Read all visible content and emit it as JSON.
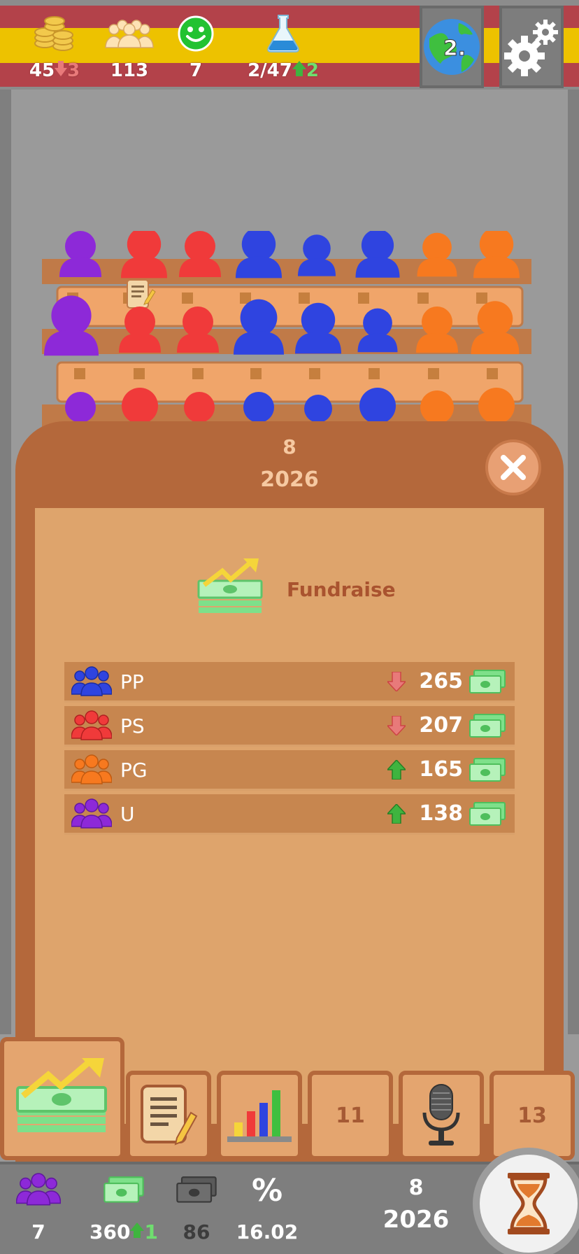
{
  "top": {
    "coins": {
      "value": "45",
      "change": "3"
    },
    "population": {
      "value": "113"
    },
    "happiness": {
      "value": "7"
    },
    "research": {
      "value": "2/47",
      "change": "2"
    },
    "world_button": {
      "label": "2."
    }
  },
  "panel": {
    "turn": "8",
    "year": "2026",
    "action": "Fundraise",
    "rows": [
      {
        "party": "PP",
        "amount": "265",
        "trend": "down",
        "color": "#2f44e0"
      },
      {
        "party": "PS",
        "amount": "207",
        "trend": "down",
        "color": "#f03a3a"
      },
      {
        "party": "PG",
        "amount": "165",
        "trend": "up",
        "color": "#f7791f"
      },
      {
        "party": "U",
        "amount": "138",
        "trend": "up",
        "color": "#8d29d8"
      }
    ]
  },
  "tabs": {
    "tab4": "11",
    "tab6": "13"
  },
  "status": {
    "members": "7",
    "money": "360",
    "money_change": "1",
    "dark_money": "86",
    "percent_icon": "%",
    "percent": "16.02",
    "turn": "8",
    "year": "2026"
  },
  "colors": {
    "purple": "#8d29d8",
    "red": "#f03a3a",
    "blue": "#2f44e0",
    "orange": "#f7791f",
    "panel": "#b4683b",
    "panel_inner": "#dea46c"
  }
}
